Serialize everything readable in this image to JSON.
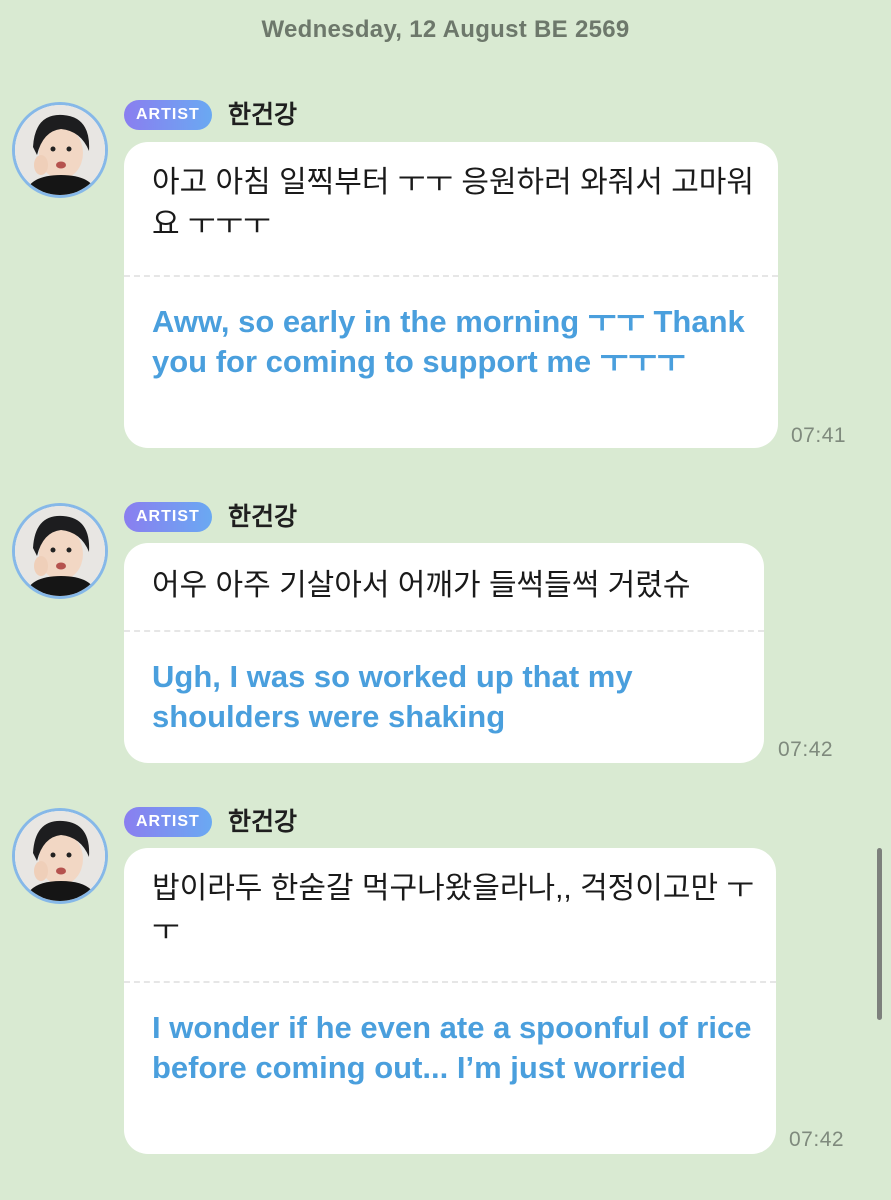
{
  "date_header": "Wednesday, 12 August BE 2569",
  "messages": [
    {
      "badge": "ARTIST",
      "sender": "한건강",
      "korean": "아고 아침 일찍부터 ㅜㅜ 응원하러 와줘서 고마워요 ㅜㅜㅜ",
      "translation": "Aww, so early in the morning ㅜㅜ Thank you for coming to support me ㅜㅜㅜ",
      "time": "07:41"
    },
    {
      "badge": "ARTIST",
      "sender": "한건강",
      "korean": "어우 아주 기살아서 어깨가 들썩들썩 거렸슈",
      "translation": "Ugh, I was so worked up that my shoulders were shaking",
      "time": "07:42"
    },
    {
      "badge": "ARTIST",
      "sender": "한건강",
      "korean": "밥이라두 한숟갈 먹구나왔을라나,, 걱정이고만 ㅜㅜ",
      "translation": "I wonder if he even ate a spoonful of rice before coming out... I’m just worried",
      "time": "07:42"
    }
  ],
  "avatar_icon": "profile-photo",
  "colors": {
    "background": "#d9ead2",
    "translation_text": "#4a9fdd",
    "badge_gradient_start": "#8a7ef0",
    "badge_gradient_end": "#6aa9f2",
    "avatar_ring": "#86b8e8"
  }
}
